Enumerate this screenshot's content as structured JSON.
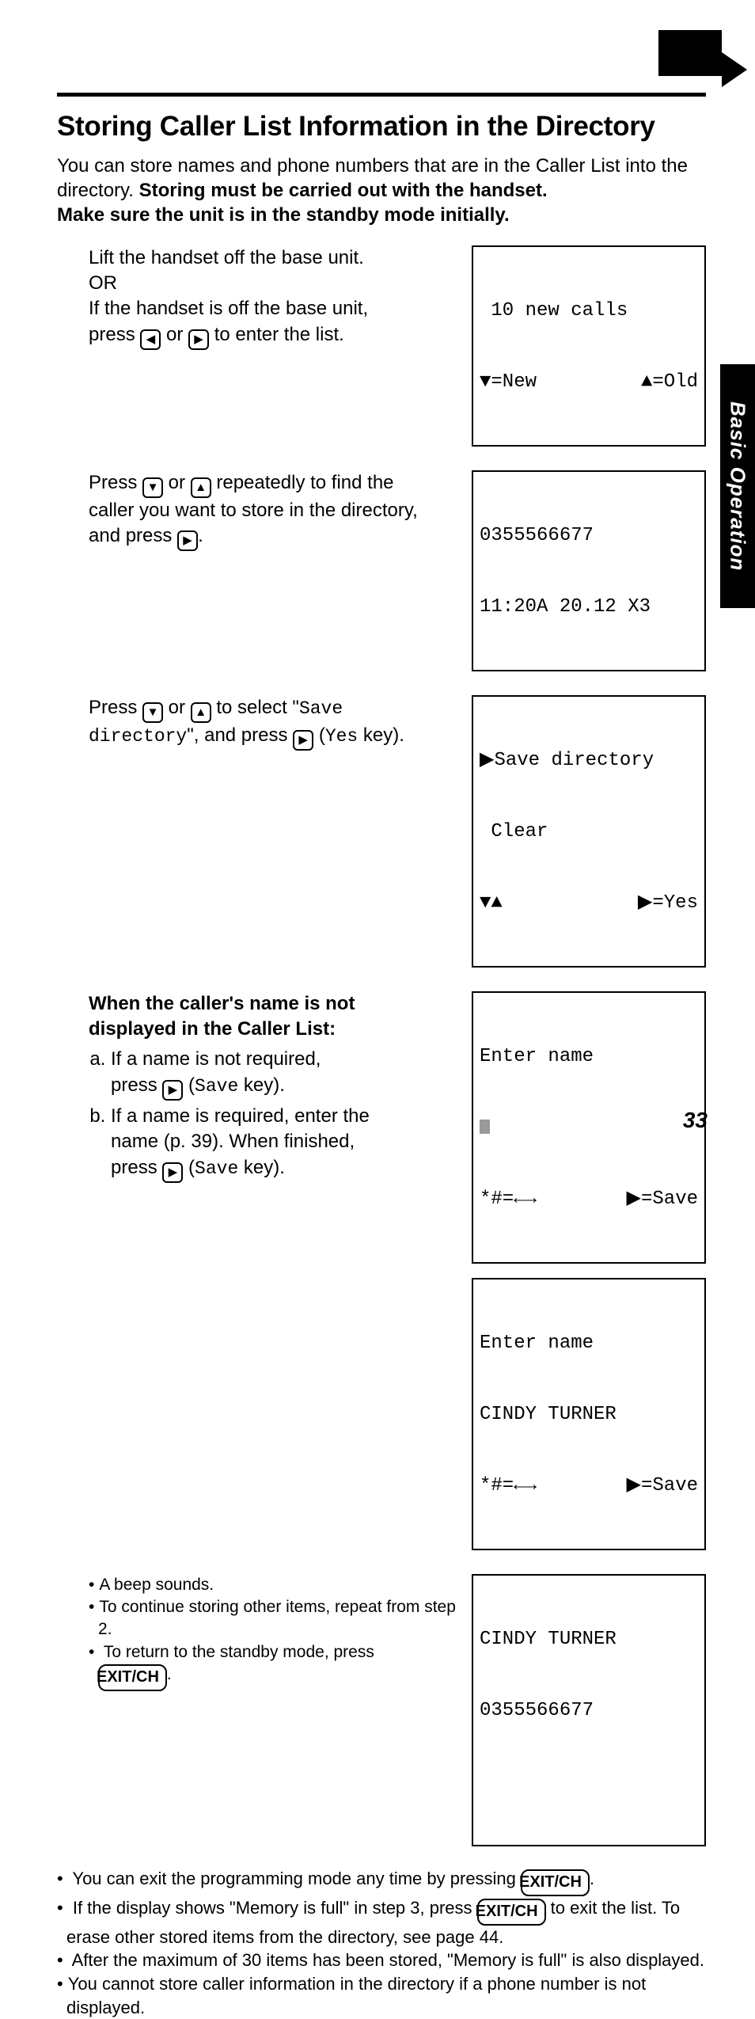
{
  "corner_arrow": "next-page",
  "heading": "Storing Caller List Information in the Directory",
  "intro_plain": "You can store names and phone numbers that are in the Caller List into the directory. ",
  "intro_bold1": "Storing must be carried out with the handset.",
  "intro_bold2": "Make sure the unit is in the standby mode initially.",
  "step1": {
    "l1": "Lift the handset off the base unit.",
    "l2": "OR",
    "l3": "If the handset is off the base unit,",
    "l4a": "press ",
    "l4b": " or ",
    "l4c": " to enter the list."
  },
  "lcd1": {
    "line1": " 10 new calls",
    "left": "▼=New",
    "right": "▲=Old"
  },
  "step2": {
    "l1a": "Press ",
    "l1b": " or ",
    "l1c": " repeatedly to find the",
    "l2": "caller you want to store in the directory,",
    "l3a": "and press ",
    "l3b": "."
  },
  "lcd2": {
    "line1": "0355566677",
    "line2": "11:20A 20.12 X3"
  },
  "step3": {
    "l1a": "Press ",
    "l1b": " or ",
    "l1c": " to select \"",
    "mono1": "Save",
    "l2a": "directory",
    "l2b": "\", and press ",
    "l2c": " (",
    "mono2": "Yes",
    "l2d": " key)."
  },
  "lcd3": {
    "line1": "▶Save directory",
    "line2": " Clear",
    "left": "▼▲",
    "right": "▶=Yes"
  },
  "step4": {
    "hb1": "When the caller's name is not",
    "hb2": "displayed in the Caller List:",
    "a1": "If a name is not required,",
    "a2a": "press ",
    "a2b": " (",
    "a2mono": "Save",
    "a2c": " key).",
    "b1": "If a name is required, enter the",
    "b2": "name (p. 39). When finished,",
    "b3a": "press ",
    "b3b": " (",
    "b3mono": "Save",
    "b3c": " key)."
  },
  "lcd4": {
    "line1": "Enter name",
    "left": "*#=←→",
    "right": "▶=Save"
  },
  "lcd5": {
    "line1": "Enter name",
    "line2": "CINDY TURNER",
    "left": "*#=←→",
    "right": "▶=Save"
  },
  "step5": {
    "b1": "A beep sounds.",
    "b2": "To continue storing other items, repeat from step 2.",
    "b3a": "To return to the standby mode, press ",
    "b3key": "EXIT/CH",
    "b3b": "."
  },
  "lcd6": {
    "line1": "CINDY TURNER",
    "line2": "0355566677"
  },
  "foot": {
    "n1a": "You can exit the programming mode any time by pressing ",
    "n1key": "EXIT/CH",
    "n1b": ".",
    "n2a": "If the display shows  \"",
    "n2mono1": "Memory is full",
    "n2b": "\" in step 3, press ",
    "n2key": "EXIT/CH",
    "n2c": " to exit the list. To erase other stored items from the directory, see page 44.",
    "n3a": "After the maximum of 30 items has been stored, \"",
    "n3mono": "Memory is full",
    "n3b": "\" is also displayed.",
    "n4": "You cannot store caller information in the directory if a phone number is not displayed."
  },
  "side_label": "Basic Operation",
  "page_number": "33",
  "keys": {
    "left": "◀",
    "right": "▶",
    "up": "▲",
    "down": "▼"
  }
}
